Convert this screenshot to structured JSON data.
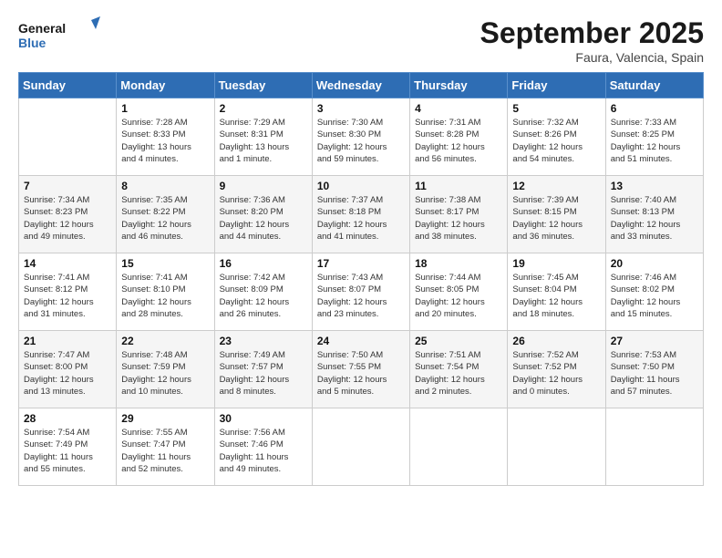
{
  "logo": {
    "text_general": "General",
    "text_blue": "Blue"
  },
  "title": {
    "main": "September 2025",
    "sub": "Faura, Valencia, Spain"
  },
  "header": {
    "days": [
      "Sunday",
      "Monday",
      "Tuesday",
      "Wednesday",
      "Thursday",
      "Friday",
      "Saturday"
    ]
  },
  "weeks": [
    [
      {
        "day": "",
        "info": ""
      },
      {
        "day": "1",
        "info": "Sunrise: 7:28 AM\nSunset: 8:33 PM\nDaylight: 13 hours\nand 4 minutes."
      },
      {
        "day": "2",
        "info": "Sunrise: 7:29 AM\nSunset: 8:31 PM\nDaylight: 13 hours\nand 1 minute."
      },
      {
        "day": "3",
        "info": "Sunrise: 7:30 AM\nSunset: 8:30 PM\nDaylight: 12 hours\nand 59 minutes."
      },
      {
        "day": "4",
        "info": "Sunrise: 7:31 AM\nSunset: 8:28 PM\nDaylight: 12 hours\nand 56 minutes."
      },
      {
        "day": "5",
        "info": "Sunrise: 7:32 AM\nSunset: 8:26 PM\nDaylight: 12 hours\nand 54 minutes."
      },
      {
        "day": "6",
        "info": "Sunrise: 7:33 AM\nSunset: 8:25 PM\nDaylight: 12 hours\nand 51 minutes."
      }
    ],
    [
      {
        "day": "7",
        "info": "Sunrise: 7:34 AM\nSunset: 8:23 PM\nDaylight: 12 hours\nand 49 minutes."
      },
      {
        "day": "8",
        "info": "Sunrise: 7:35 AM\nSunset: 8:22 PM\nDaylight: 12 hours\nand 46 minutes."
      },
      {
        "day": "9",
        "info": "Sunrise: 7:36 AM\nSunset: 8:20 PM\nDaylight: 12 hours\nand 44 minutes."
      },
      {
        "day": "10",
        "info": "Sunrise: 7:37 AM\nSunset: 8:18 PM\nDaylight: 12 hours\nand 41 minutes."
      },
      {
        "day": "11",
        "info": "Sunrise: 7:38 AM\nSunset: 8:17 PM\nDaylight: 12 hours\nand 38 minutes."
      },
      {
        "day": "12",
        "info": "Sunrise: 7:39 AM\nSunset: 8:15 PM\nDaylight: 12 hours\nand 36 minutes."
      },
      {
        "day": "13",
        "info": "Sunrise: 7:40 AM\nSunset: 8:13 PM\nDaylight: 12 hours\nand 33 minutes."
      }
    ],
    [
      {
        "day": "14",
        "info": "Sunrise: 7:41 AM\nSunset: 8:12 PM\nDaylight: 12 hours\nand 31 minutes."
      },
      {
        "day": "15",
        "info": "Sunrise: 7:41 AM\nSunset: 8:10 PM\nDaylight: 12 hours\nand 28 minutes."
      },
      {
        "day": "16",
        "info": "Sunrise: 7:42 AM\nSunset: 8:09 PM\nDaylight: 12 hours\nand 26 minutes."
      },
      {
        "day": "17",
        "info": "Sunrise: 7:43 AM\nSunset: 8:07 PM\nDaylight: 12 hours\nand 23 minutes."
      },
      {
        "day": "18",
        "info": "Sunrise: 7:44 AM\nSunset: 8:05 PM\nDaylight: 12 hours\nand 20 minutes."
      },
      {
        "day": "19",
        "info": "Sunrise: 7:45 AM\nSunset: 8:04 PM\nDaylight: 12 hours\nand 18 minutes."
      },
      {
        "day": "20",
        "info": "Sunrise: 7:46 AM\nSunset: 8:02 PM\nDaylight: 12 hours\nand 15 minutes."
      }
    ],
    [
      {
        "day": "21",
        "info": "Sunrise: 7:47 AM\nSunset: 8:00 PM\nDaylight: 12 hours\nand 13 minutes."
      },
      {
        "day": "22",
        "info": "Sunrise: 7:48 AM\nSunset: 7:59 PM\nDaylight: 12 hours\nand 10 minutes."
      },
      {
        "day": "23",
        "info": "Sunrise: 7:49 AM\nSunset: 7:57 PM\nDaylight: 12 hours\nand 8 minutes."
      },
      {
        "day": "24",
        "info": "Sunrise: 7:50 AM\nSunset: 7:55 PM\nDaylight: 12 hours\nand 5 minutes."
      },
      {
        "day": "25",
        "info": "Sunrise: 7:51 AM\nSunset: 7:54 PM\nDaylight: 12 hours\nand 2 minutes."
      },
      {
        "day": "26",
        "info": "Sunrise: 7:52 AM\nSunset: 7:52 PM\nDaylight: 12 hours\nand 0 minutes."
      },
      {
        "day": "27",
        "info": "Sunrise: 7:53 AM\nSunset: 7:50 PM\nDaylight: 11 hours\nand 57 minutes."
      }
    ],
    [
      {
        "day": "28",
        "info": "Sunrise: 7:54 AM\nSunset: 7:49 PM\nDaylight: 11 hours\nand 55 minutes."
      },
      {
        "day": "29",
        "info": "Sunrise: 7:55 AM\nSunset: 7:47 PM\nDaylight: 11 hours\nand 52 minutes."
      },
      {
        "day": "30",
        "info": "Sunrise: 7:56 AM\nSunset: 7:46 PM\nDaylight: 11 hours\nand 49 minutes."
      },
      {
        "day": "",
        "info": ""
      },
      {
        "day": "",
        "info": ""
      },
      {
        "day": "",
        "info": ""
      },
      {
        "day": "",
        "info": ""
      }
    ]
  ]
}
